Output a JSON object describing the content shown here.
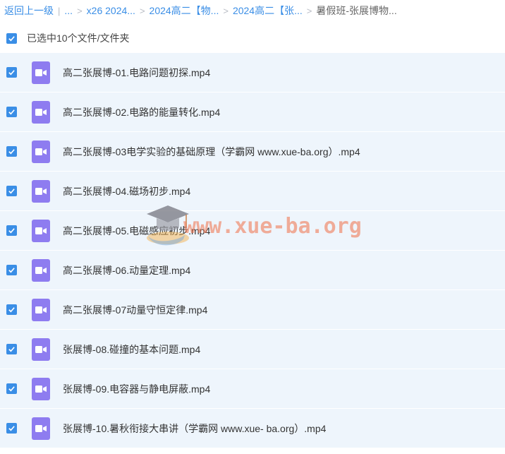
{
  "breadcrumb": {
    "back": "返回上一级",
    "ellipsis": "...",
    "items": [
      "x26 2024...",
      "2024高二【物...",
      "2024高二【张..."
    ],
    "current": "暑假班-张展博物..."
  },
  "selection": {
    "label": "已选中10个文件/文件夹"
  },
  "files": [
    {
      "name": "高二张展博-01.电路问题初探.mp4"
    },
    {
      "name": "高二张展博-02.电路的能量转化.mp4"
    },
    {
      "name": "高二张展博-03电学实验的基础原理（学霸网 www.xue-ba.org）.mp4"
    },
    {
      "name": "高二张展博-04.磁场初步.mp4"
    },
    {
      "name": "高二张展博-05.电磁感应初步.mp4"
    },
    {
      "name": "高二张展博-06.动量定理.mp4"
    },
    {
      "name": "高二张展博-07动量守恒定律.mp4"
    },
    {
      "name": "张展博-08.碰撞的基本问题.mp4"
    },
    {
      "name": "张展博-09.电容器与静电屏蔽.mp4"
    },
    {
      "name": "张展博-10.暑秋衔接大串讲（学霸网 www.xue- ba.org）.mp4"
    }
  ],
  "watermark": {
    "text": "www.xue-ba.org"
  },
  "colors": {
    "accent": "#3a8ee6",
    "row_bg": "#eef5fc",
    "video_icon": "#8e7cf0"
  }
}
